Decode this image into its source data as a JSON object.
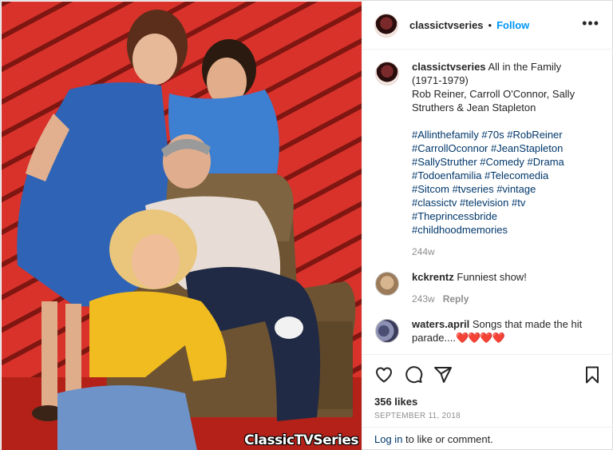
{
  "post": {
    "username": "classictvseries",
    "separator": "•",
    "follow_label": "Follow",
    "more_label": "•••",
    "watermark": {
      "part1": "Classic",
      "part2": "TV",
      "part3": "Series"
    }
  },
  "caption": {
    "username": "classictvseries",
    "line1": "All in the Family",
    "line2": "(1971-1979)",
    "line3": "Rob Reiner, Carroll O'Connor, Sally",
    "line4": "Struthers & Jean Stapleton",
    "tags": [
      "#Allinthefamily #70s #RobReiner",
      "#CarrollOconnor #JeanStapleton",
      "#SallyStruther #Comedy #Drama",
      "#Todoenfamilia #Telecomedia",
      "#Sitcom #tvseries #vintage",
      "#classictv #television #tv",
      "#Theprincessbride",
      "#childhoodmemories"
    ],
    "age": "244w"
  },
  "comments": [
    {
      "username": "kckrentz",
      "text": "Funniest show!",
      "age": "243w",
      "reply_label": "Reply"
    },
    {
      "username": "waters.april",
      "text": "Songs that made the hit parade....",
      "hearts": "❤️❤️❤️❤️"
    }
  ],
  "actions": {
    "icons": [
      "heart-icon",
      "comment-icon",
      "share-icon",
      "bookmark-icon"
    ],
    "likes": "356 likes",
    "date": "SEPTEMBER 11, 2018"
  },
  "login": {
    "link": "Log in",
    "rest": " to like or comment."
  },
  "colors": {
    "link_blue": "#0095f6",
    "hashtag_blue": "#00376b",
    "muted_gray": "#8e8e8e",
    "background_red": "#d6322c"
  }
}
